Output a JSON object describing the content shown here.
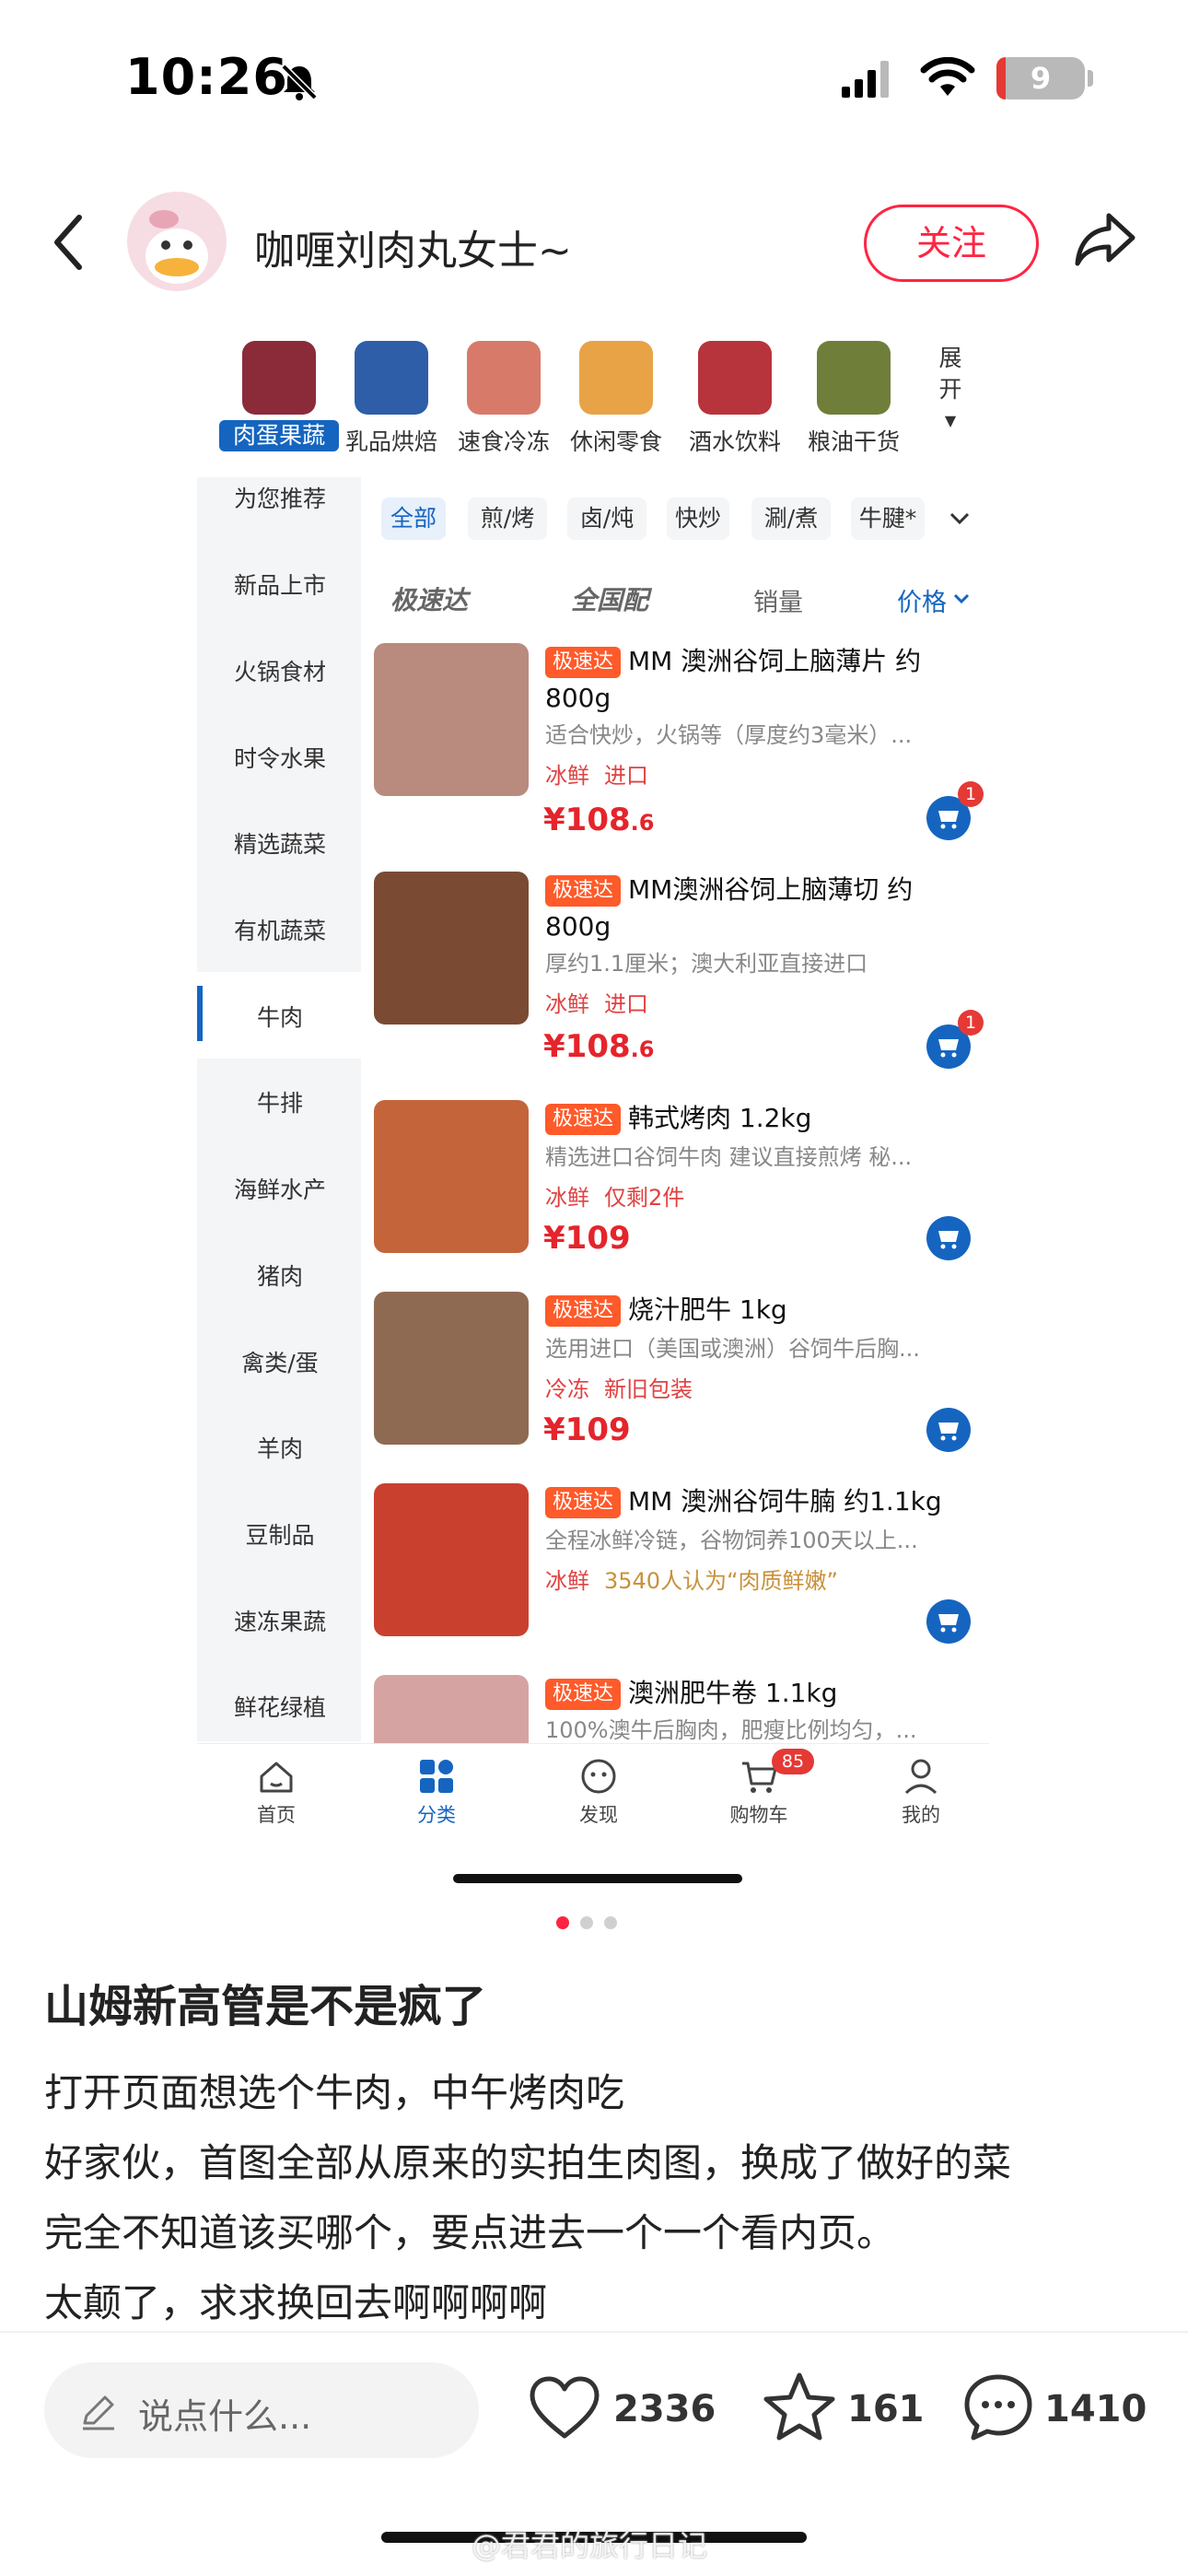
{
  "status_bar": {
    "time": "10:26",
    "battery": "9"
  },
  "header": {
    "author_name": "咖喱刘肉丸女士~",
    "follow_label": "关注"
  },
  "inner": {
    "categories": [
      {
        "label": "肉蛋果蔬",
        "selected": true,
        "color": "#8b2b3a"
      },
      {
        "label": "乳品烘焙",
        "color": "#2e5ea8"
      },
      {
        "label": "速食冷冻",
        "color": "#d87a6a"
      },
      {
        "label": "休闲零食",
        "color": "#e8a347"
      },
      {
        "label": "酒水饮料",
        "color": "#b8343c"
      },
      {
        "label": "粮油干货",
        "color": "#6f7f3a"
      }
    ],
    "expand_label": [
      "展",
      "开"
    ],
    "sidebar": [
      "为您推荐",
      "新品上市",
      "火锅食材",
      "时令水果",
      "精选蔬菜",
      "有机蔬菜",
      "牛肉",
      "牛排",
      "海鲜水产",
      "猪肉",
      "禽类/蛋",
      "羊肉",
      "豆制品",
      "速冻果蔬",
      "鲜花绿植"
    ],
    "sidebar_selected": "牛肉",
    "chips": [
      "全部",
      "煎/烤",
      "卤/炖",
      "快炒",
      "涮/煮",
      "牛腱*"
    ],
    "sort": {
      "express": "极速达",
      "national": "全国配",
      "sales": "销量",
      "price": "价格"
    },
    "products": [
      {
        "badge": "极速达",
        "title": "MM 澳洲谷饲上脑薄片 约800g",
        "desc": "适合快炒，火锅等（厚度约3毫米）...",
        "tags": [
          "冰鲜",
          "进口"
        ],
        "price_main": "¥108",
        "price_dec": ".6",
        "cart_count": "1",
        "img": "#b98a7e"
      },
      {
        "badge": "极速达",
        "title": "MM澳洲谷饲上脑薄切 约800g",
        "desc": "厚约1.1厘米；澳大利亚直接进口",
        "tags": [
          "冰鲜",
          "进口"
        ],
        "price_main": "¥108",
        "price_dec": ".6",
        "cart_count": "1",
        "img": "#7a4a33"
      },
      {
        "badge": "极速达",
        "title": "韩式烤肉 1.2kg",
        "desc": "精选进口谷饲牛肉 建议直接煎烤 秘...",
        "tags": [
          "冰鲜",
          "仅剩2件"
        ],
        "price_main": "¥109",
        "price_dec": "",
        "cart_count": "",
        "img": "#c4643b"
      },
      {
        "badge": "极速达",
        "title": "烧汁肥牛 1kg",
        "desc": "选用进口（美国或澳洲）谷饲牛后胸...",
        "tags": [
          "冷冻",
          "新旧包装"
        ],
        "price_main": "¥109",
        "price_dec": "",
        "cart_count": "",
        "img": "#8f6a52"
      },
      {
        "badge": "极速达",
        "title": "MM 澳洲谷饲牛腩 约1.1kg",
        "desc": "全程冰鲜冷链，谷物饲养100天以上...",
        "tags": [
          "冰鲜",
          "3540人认为“肉质鲜嫩”"
        ],
        "price_main": "",
        "price_dec": "",
        "cart_count": "",
        "img": "#c9402f"
      },
      {
        "badge": "极速达",
        "title": "澳洲肥牛卷 1.1kg",
        "desc": "100%澳牛后胸肉，肥瘦比例均匀，...",
        "tags": [],
        "price_main": "",
        "price_dec": "",
        "cart_count": "",
        "img": "#d6a3a3"
      }
    ],
    "nav": [
      {
        "label": "首页"
      },
      {
        "label": "分类",
        "active": true
      },
      {
        "label": "发现"
      },
      {
        "label": "购物车",
        "badge": "85"
      },
      {
        "label": "我的"
      }
    ]
  },
  "post": {
    "title": "山姆新高管是不是疯了",
    "lines": [
      "打开页面想选个牛肉，中午烤肉吃",
      "好家伙，首图全部从原来的实拍生肉图，换成了做好的菜",
      "完全不知道该买哪个，要点进去一个一个看内页。",
      "太颠了，求求换回去啊啊啊啊"
    ]
  },
  "bottom": {
    "comment_placeholder": "说点什么...",
    "likes": "2336",
    "stars": "161",
    "comments": "1410"
  },
  "watermark": "@君君的旅行日记",
  "colors": {
    "accent": "#ff2442",
    "blue": "#1565c0",
    "price": "#e5242b"
  }
}
